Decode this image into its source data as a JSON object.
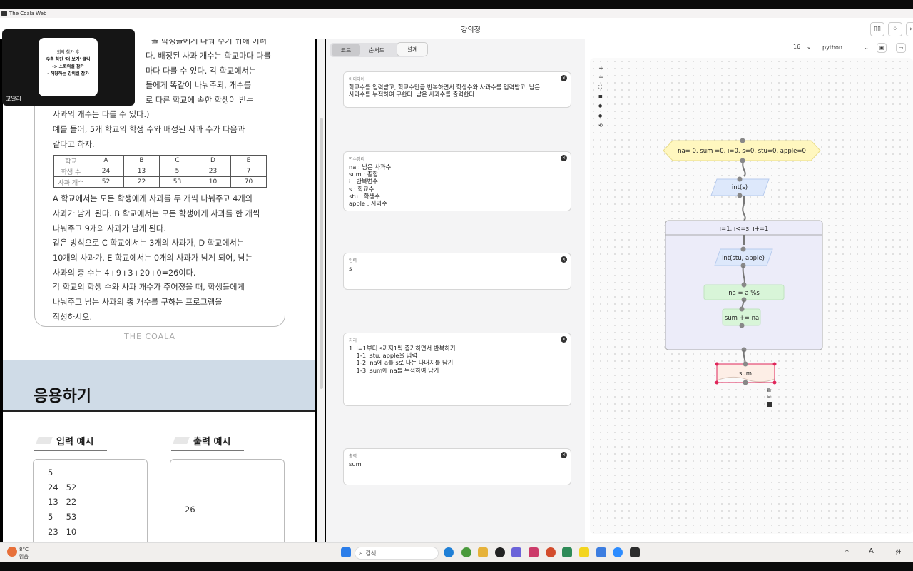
{
  "window": {
    "app_title": "The Coala Web",
    "page_title": "강의정"
  },
  "overlay": {
    "lines": [
      "회의 참가 후",
      "우측 하단 '더 보기' 클릭",
      "-> 소회의실 참가",
      "- 해당하는 강의실 참가"
    ],
    "name": "코알라"
  },
  "doc": {
    "logo_top": "THE COALA",
    "lines": [
      "을 학생들에게 나눠 주기 위해 여러",
      "다. 배정된 사과 개수는 학교마다 다를",
      "마다 다를 수 있다. 각 학교에서는",
      "들에게 똑같이 나눠주되, 개수를",
      "로 다른 학교에 속한 학생이 받는",
      "사과의 개수는 다를 수 있다.)",
      "예를 들어, 5개 학교의 학생 수와 배정된 사과 수가 다음과",
      "같다고 하자."
    ],
    "table": {
      "header": [
        "학교",
        "A",
        "B",
        "C",
        "D",
        "E"
      ],
      "rows": [
        [
          "학생 수",
          "24",
          "13",
          "5",
          "23",
          "7"
        ],
        [
          "사과 개수",
          "52",
          "22",
          "53",
          "10",
          "70"
        ]
      ]
    },
    "lines2": [
      "A 학교에서는 모든 학생에게 사과를 두 개씩 나눠주고 4개의",
      "사과가 남게 된다. B 학교에서는 모든 학생에게 사과를 한 개씩",
      "나눠주고 9개의 사과가 남게 된다.",
      "같은 방식으로 C 학교에서는 3개의 사과가, D 학교에서는",
      "10개의 사과가, E 학교에서는 0개의 사과가 남게 되어, 남는",
      "사과의 총 수는 4+9+3+20+0=26이다.",
      "각 학교의 학생 수와 사과 개수가 주어졌을 때, 학생들에게",
      "나눠주고 남는 사과의 총 개수를 구하는 프로그램을",
      "작성하시오."
    ],
    "logo_bottom": "THE COALA",
    "apply_title": "응용하기",
    "input_label": "입력 예시",
    "output_label": "출력 예시",
    "input_lines": [
      "5",
      "24   52",
      "13   22",
      "5     53",
      "23   10"
    ],
    "output_value": "26"
  },
  "mid": {
    "tabs": [
      "코드",
      "순서도"
    ],
    "design": "설계",
    "steps": [
      {
        "label": "아이디어",
        "body": "학교수를 입력받고, 학교수만큼 반복하면서 학생수와 사과수를 입력받고, 남은\n사과수를 누적하여 구한다. 남은 사과수를 출력한다."
      },
      {
        "label": "변수정리",
        "body": "na : 남은 사과수\nsum : 총합\ni : 반복변수\ns : 학교수\nstu : 학생수\napple : 사과수"
      },
      {
        "label": "입력",
        "body": "s"
      },
      {
        "label": "처리",
        "body": "1. i=1부터 s까지1씩 증가하면서 반복하기\n    1-1. stu, apple을 입력\n    1-2. na에 a를 s로 나눈 나머지를 담기\n    1-3. sum에 na를 누적하여 담기"
      },
      {
        "label": "출력",
        "body": "sum"
      }
    ]
  },
  "right": {
    "font_size": "16",
    "language": "python",
    "flow": {
      "start": "na= 0, sum =0, i=0, s=0, stu=0, apple=0",
      "input1": "int(s)",
      "loop": "i=1, i<=s, i+=1",
      "input2": "int(stu, apple)",
      "proc1": "na = a %s",
      "proc2": "sum += na",
      "output": "sum"
    }
  },
  "taskbar": {
    "weather_temp": "8°C",
    "weather_desc": "맑음",
    "search": "검색",
    "lang": "A",
    "ime": "한"
  }
}
